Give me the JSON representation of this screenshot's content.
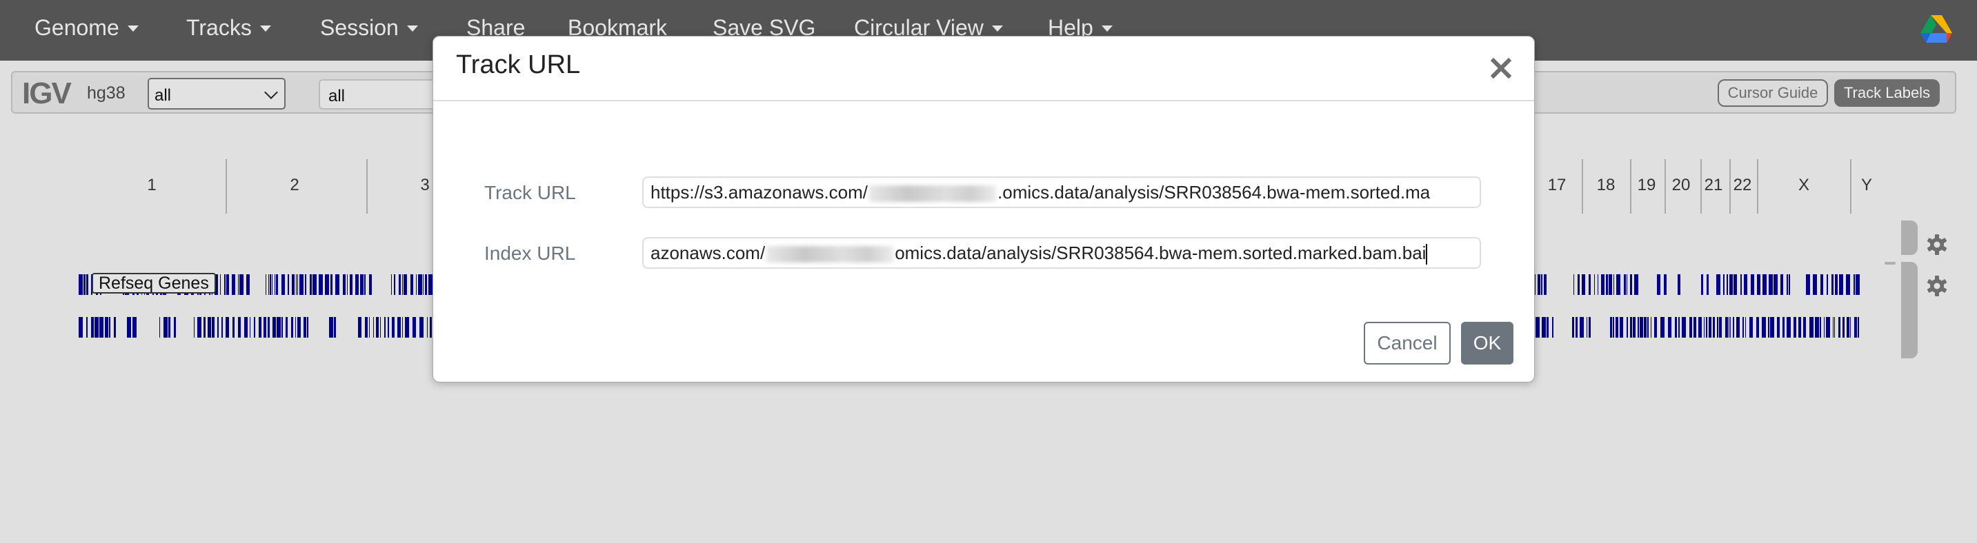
{
  "navbar": {
    "items": [
      {
        "label": "Genome",
        "dropdown": true
      },
      {
        "label": "Tracks",
        "dropdown": true
      },
      {
        "label": "Session",
        "dropdown": true
      },
      {
        "label": "Share",
        "dropdown": false
      },
      {
        "label": "Bookmark",
        "dropdown": false
      },
      {
        "label": "Save SVG",
        "dropdown": false
      },
      {
        "label": "Circular View",
        "dropdown": true
      },
      {
        "label": "Help",
        "dropdown": true
      }
    ],
    "drive_icon": "google-drive-icon"
  },
  "toolbar": {
    "logo": "IGV",
    "genome": "hg38",
    "chromosome_select": "all",
    "locus_input": "all",
    "cursor_guide_label": "Cursor Guide",
    "track_labels_label": "Track Labels",
    "track_labels_active": true
  },
  "ruler": {
    "chromosomes_visible": [
      "1",
      "2",
      "3",
      "17",
      "18",
      "19",
      "20",
      "21",
      "22",
      "X",
      "Y"
    ]
  },
  "tracks": [
    {
      "name": "Refseq Genes",
      "color": "#000088"
    },
    {
      "name": "",
      "color": "#000088"
    }
  ],
  "modal": {
    "title": "Track URL",
    "close_icon": "close-icon",
    "fields": [
      {
        "label": "Track URL",
        "value_prefix": "https://s3.amazonaws.com/",
        "value_redacted": true,
        "value_suffix": ".omics.data/analysis/SRR038564.bwa-mem.sorted.ma"
      },
      {
        "label": "Index URL",
        "value_prefix": "azonaws.com/",
        "value_redacted": true,
        "value_suffix": "omics.data/analysis/SRR038564.bwa-mem.sorted.marked.bam.bai"
      }
    ],
    "cancel_label": "Cancel",
    "ok_label": "OK"
  },
  "colors": {
    "navbar_bg": "#545454",
    "track_feature": "#000088",
    "button_secondary": "#6c757d"
  }
}
